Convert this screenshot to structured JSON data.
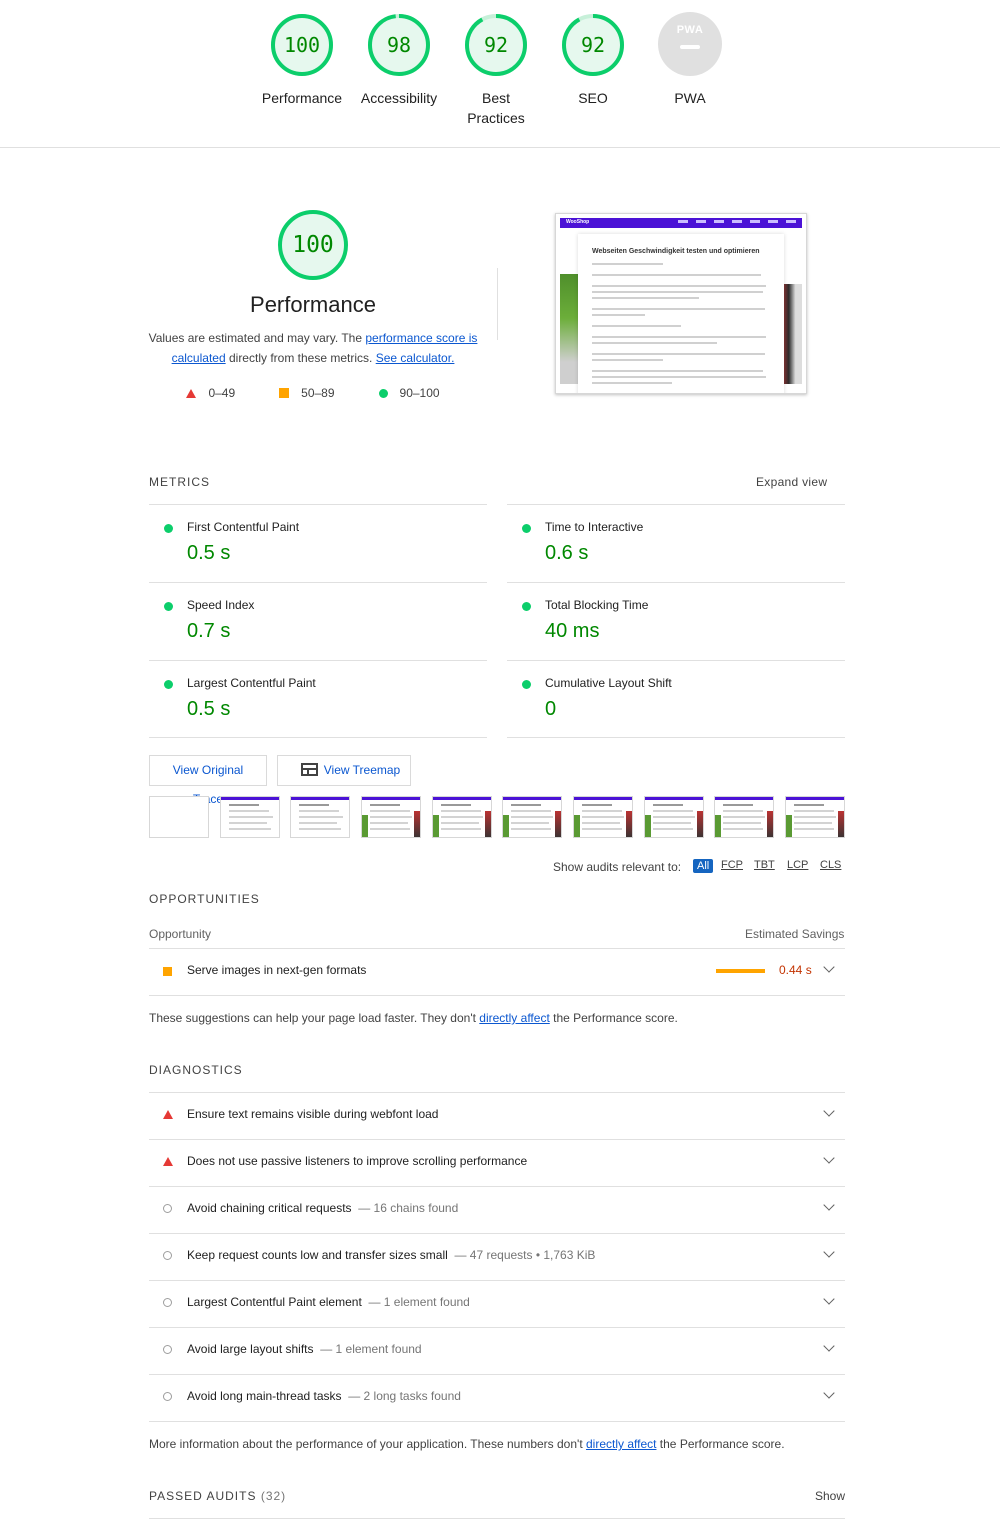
{
  "gauges": [
    {
      "score": "100",
      "label": "Performance",
      "fraction": 1.0
    },
    {
      "score": "98",
      "label": "Accessibility",
      "fraction": 0.98
    },
    {
      "score": "92",
      "label": "Best Practices",
      "fraction": 0.92
    },
    {
      "score": "92",
      "label": "SEO",
      "fraction": 0.92
    },
    {
      "score": "",
      "label": "PWA",
      "badge": "PWA"
    }
  ],
  "perf": {
    "score": "100",
    "title": "Performance",
    "desc_1": "Values are estimated and may vary. The ",
    "link_score": "performance score is calculated",
    "desc_2": " directly from these metrics. ",
    "link_calc": "See calculator.",
    "legend": [
      "0–49",
      "50–89",
      "90–100"
    ]
  },
  "thumbnail": {
    "brand": "WooShop",
    "heading": "Webseiten Geschwindigkeit testen und optimieren"
  },
  "metrics": {
    "title": "METRICS",
    "expand": "Expand view",
    "items": [
      {
        "name": "First Contentful Paint",
        "value": "0.5 s"
      },
      {
        "name": "Time to Interactive",
        "value": "0.6 s"
      },
      {
        "name": "Speed Index",
        "value": "0.7 s"
      },
      {
        "name": "Total Blocking Time",
        "value": "40 ms"
      },
      {
        "name": "Largest Contentful Paint",
        "value": "0.5 s"
      },
      {
        "name": "Cumulative Layout Shift",
        "value": "0"
      }
    ]
  },
  "buttons": {
    "trace": "View Original Trace",
    "treemap": "View Treemap"
  },
  "filter": {
    "label": "Show audits relevant to:",
    "chips": [
      "All",
      "FCP",
      "TBT",
      "LCP",
      "CLS"
    ]
  },
  "opportunities": {
    "title": "OPPORTUNITIES",
    "col_left": "Opportunity",
    "col_right": "Estimated Savings",
    "items": [
      {
        "title": "Serve images in next-gen formats",
        "savings": "0.44 s",
        "bar_fraction": 0.44
      }
    ],
    "note_1": "These suggestions can help your page load faster. They don't ",
    "note_link": "directly affect",
    "note_2": " the Performance score."
  },
  "diagnostics": {
    "title": "DIAGNOSTICS",
    "items": [
      {
        "title": "Ensure text remains visible during webfont load",
        "detail": "",
        "status": "fail"
      },
      {
        "title": "Does not use passive listeners to improve scrolling performance",
        "detail": "",
        "status": "fail"
      },
      {
        "title": "Avoid chaining critical requests",
        "detail": "— 16 chains found",
        "status": "info"
      },
      {
        "title": "Keep request counts low and transfer sizes small",
        "detail": "— 47 requests • 1,763 KiB",
        "status": "info"
      },
      {
        "title": "Largest Contentful Paint element",
        "detail": "— 1 element found",
        "status": "info"
      },
      {
        "title": "Avoid large layout shifts",
        "detail": "— 1 element found",
        "status": "info"
      },
      {
        "title": "Avoid long main-thread tasks",
        "detail": "— 2 long tasks found",
        "status": "info"
      }
    ],
    "note_1": "More information about the performance of your application. These numbers don't ",
    "note_link": "directly affect",
    "note_2": " the Performance score."
  },
  "passed": {
    "title": "PASSED AUDITS",
    "count": "(32)",
    "show": "Show"
  },
  "colors": {
    "pass": "#0cce6b",
    "pass_text": "#008800",
    "average": "#ffa400",
    "fail": "#e53935",
    "link": "#0b57d0"
  }
}
